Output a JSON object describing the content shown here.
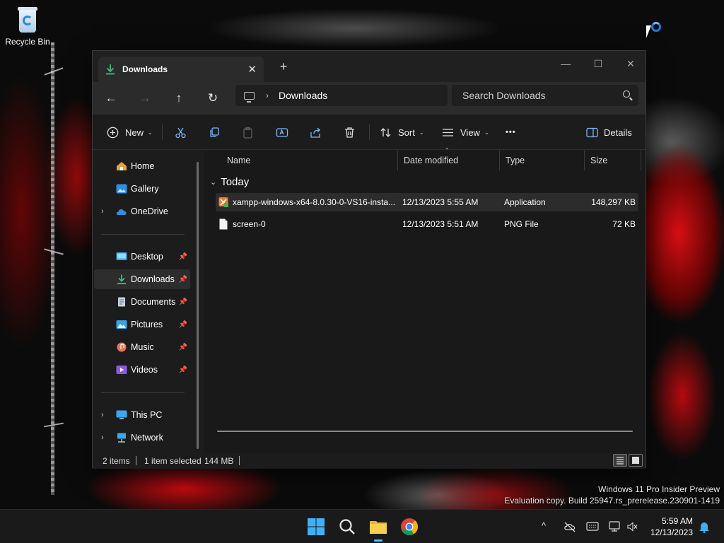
{
  "desktop": {
    "recycle_bin_label": "Recycle Bin",
    "watermark_line1": "Windows 11 Pro Insider Preview",
    "watermark_line2": "Evaluation copy. Build 25947.rs_prerelease.230901-1419"
  },
  "window": {
    "tab_title": "Downloads",
    "tab_close": "✕",
    "new_tab": "+",
    "minimize": "—",
    "maximize": "☐",
    "close": "✕"
  },
  "address": {
    "back": "←",
    "forward": "→",
    "up": "↑",
    "refresh": "↻",
    "crumb_separator": "›",
    "crumb": "Downloads",
    "search_placeholder": "Search Downloads"
  },
  "toolbar": {
    "new_label": "New",
    "sort_label": "Sort",
    "view_label": "View",
    "more_label": "•••",
    "details_label": "Details",
    "caret": "⌄"
  },
  "nav": {
    "expand": "›",
    "pin": "📌",
    "items": [
      {
        "label": "Home"
      },
      {
        "label": "Gallery"
      },
      {
        "label": "OneDrive"
      },
      {
        "label": "Desktop"
      },
      {
        "label": "Downloads"
      },
      {
        "label": "Documents"
      },
      {
        "label": "Pictures"
      },
      {
        "label": "Music"
      },
      {
        "label": "Videos"
      },
      {
        "label": "This PC"
      },
      {
        "label": "Network"
      }
    ]
  },
  "content": {
    "columns": [
      "Name",
      "Date modified",
      "Type",
      "Size"
    ],
    "sort_caret": "⌃",
    "group_chevron": "⌄",
    "group_label": "Today",
    "files": [
      {
        "name": "xampp-windows-x64-8.0.30-0-VS16-insta...",
        "date": "12/13/2023 5:55 AM",
        "type": "Application",
        "size": "148,297 KB"
      },
      {
        "name": "screen-0",
        "date": "12/13/2023 5:51 AM",
        "type": "PNG File",
        "size": "72 KB"
      }
    ]
  },
  "status": {
    "items": "2 items",
    "selected": "1 item selected",
    "size": "144 MB"
  },
  "taskbar": {
    "time": "5:59 AM",
    "date": "12/13/2023",
    "tray_chevron": "^"
  },
  "colors": {
    "accent": "#4cc2ff",
    "download_green": "#3fbf7f",
    "folder_yellow": "#f2c53d"
  }
}
